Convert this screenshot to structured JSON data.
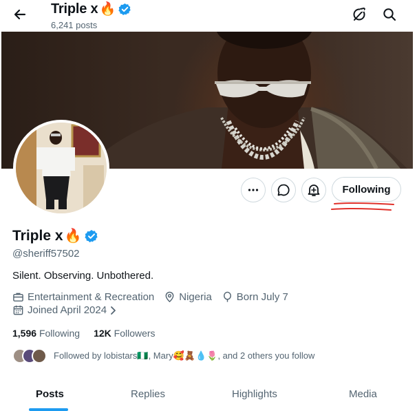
{
  "header": {
    "title": "Triple x",
    "title_emoji": "🔥",
    "posts_count": "6,241 posts",
    "icons": [
      "back-arrow-icon",
      "grok-icon",
      "search-icon"
    ]
  },
  "profile": {
    "name": "Triple x",
    "name_emoji": "🔥",
    "verified": true,
    "handle": "@sheriff57502",
    "bio": "Silent. Observing. Unbothered.",
    "category": "Entertainment & Recreation",
    "location": "Nigeria",
    "born": "Born July 7",
    "joined": "Joined April 2024",
    "following_count": "1,596",
    "following_label": "Following",
    "followers_count": "12K",
    "followers_label": "Followers",
    "followed_by_prefix": "Followed by lobistars",
    "followed_by_emoji_1": "🇳🇬",
    "followed_by_mid": ", Mary",
    "followed_by_emoji_2": "🥰🧸💧🌷",
    "followed_by_suffix": ", and 2 others you follow"
  },
  "actions": {
    "following_label": "Following",
    "icons": [
      "more-icon",
      "message-icon",
      "notification-bell-icon"
    ]
  },
  "tabs": [
    {
      "label": "Posts",
      "active": true
    },
    {
      "label": "Replies",
      "active": false
    },
    {
      "label": "Highlights",
      "active": false
    },
    {
      "label": "Media",
      "active": false
    }
  ],
  "colors": {
    "accent": "#1d9bf0",
    "verified": "#1d9bf0",
    "text_primary": "#0f1419",
    "text_secondary": "#536471",
    "annotation_red": "#e0302a"
  }
}
